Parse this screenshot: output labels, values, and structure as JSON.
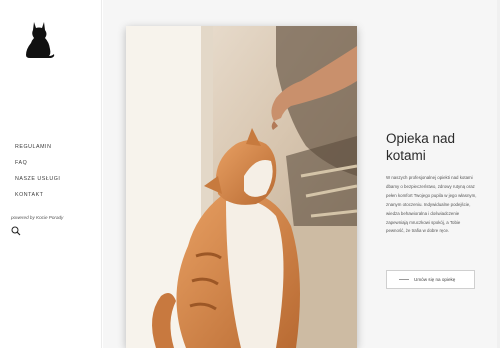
{
  "sidebar": {
    "logo_icon": "cat-silhouette-icon",
    "nav_items": [
      {
        "label": "REGULAMIN"
      },
      {
        "label": "FAQ"
      },
      {
        "label": "NASZE USŁUGI"
      },
      {
        "label": "KONTAKT"
      }
    ],
    "powered_by": "powered by Kocie Porady",
    "search_icon": "search-icon"
  },
  "main": {
    "image_alt_icon": "cat-photo",
    "heading": "Opieka nad kotami",
    "description": "W naszych profesjonalnej opiekti nad kotami dbamy o bezpieczeństwo, zdrowy rutyną oraz pełen komfort Twojego pupila w jego własnym, znanym otoczeniu. Indywidualne podejście, wiedza behawioralna i doświadczenie zapewniają mruczkowi spokój, a Tobie pewność, że trafia w dobre ręce.",
    "cta_label": "Umów się na opiekę"
  },
  "colors": {
    "sidebar_bg": "#ffffff",
    "main_bg": "#f6f6f6",
    "text": "#2b2b2b"
  }
}
